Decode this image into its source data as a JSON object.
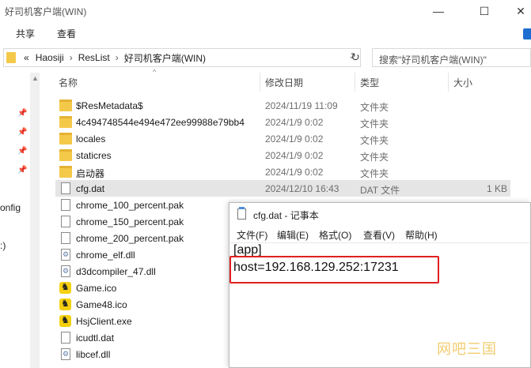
{
  "explorer": {
    "title": "好司机客户端(WIN)",
    "ribbon_tabs": [
      "共享",
      "查看"
    ],
    "address": {
      "overflow": "«",
      "crumbs": [
        "Haosiji",
        "ResList",
        "好司机客户端(WIN)"
      ],
      "separator": "›"
    },
    "search_placeholder": "搜索\"好司机客户端(WIN)\"",
    "left_nav_partial": [
      "onfig",
      ":)"
    ],
    "columns": {
      "name": "名称",
      "date": "修改日期",
      "type": "类型",
      "size": "大小"
    },
    "files": [
      {
        "icon": "folder",
        "name": "$ResMetadata$",
        "date": "2024/11/19 11:09",
        "type": "文件夹",
        "size": ""
      },
      {
        "icon": "folder",
        "name": "4c494748544e494e472ee99988e79bb4",
        "date": "2024/1/9 0:02",
        "type": "文件夹",
        "size": ""
      },
      {
        "icon": "folder",
        "name": "locales",
        "date": "2024/1/9 0:02",
        "type": "文件夹",
        "size": ""
      },
      {
        "icon": "folder",
        "name": "staticres",
        "date": "2024/1/9 0:02",
        "type": "文件夹",
        "size": ""
      },
      {
        "icon": "folder",
        "name": "启动器",
        "date": "2024/1/9 0:02",
        "type": "文件夹",
        "size": ""
      },
      {
        "icon": "file",
        "name": "cfg.dat",
        "date": "2024/12/10 16:43",
        "type": "DAT 文件",
        "size": "1 KB",
        "selected": true
      },
      {
        "icon": "file",
        "name": "chrome_100_percent.pak",
        "date": "",
        "type": "",
        "size": ""
      },
      {
        "icon": "file",
        "name": "chrome_150_percent.pak",
        "date": "",
        "type": "",
        "size": ""
      },
      {
        "icon": "file",
        "name": "chrome_200_percent.pak",
        "date": "",
        "type": "",
        "size": ""
      },
      {
        "icon": "gear",
        "name": "chrome_elf.dll",
        "date": "",
        "type": "",
        "size": ""
      },
      {
        "icon": "gear",
        "name": "d3dcompiler_47.dll",
        "date": "",
        "type": "",
        "size": ""
      },
      {
        "icon": "game",
        "name": "Game.ico",
        "date": "",
        "type": "",
        "size": ""
      },
      {
        "icon": "game",
        "name": "Game48.ico",
        "date": "",
        "type": "",
        "size": ""
      },
      {
        "icon": "game",
        "name": "HsjClient.exe",
        "date": "",
        "type": "",
        "size": ""
      },
      {
        "icon": "file",
        "name": "icudtl.dat",
        "date": "",
        "type": "",
        "size": ""
      },
      {
        "icon": "gear",
        "name": "libcef.dll",
        "date": "",
        "type": "",
        "size": ""
      }
    ]
  },
  "notepad": {
    "title": "cfg.dat - 记事本",
    "menu": [
      "文件(F)",
      "编辑(E)",
      "格式(O)",
      "查看(V)",
      "帮助(H)"
    ],
    "lines": [
      "[app]",
      "host=192.168.129.252:17231"
    ]
  },
  "watermark": "网吧三国",
  "colors": {
    "highlight_border": "#e02020",
    "folder": "#f4c94a",
    "selected_row": "#e5e5e5"
  }
}
